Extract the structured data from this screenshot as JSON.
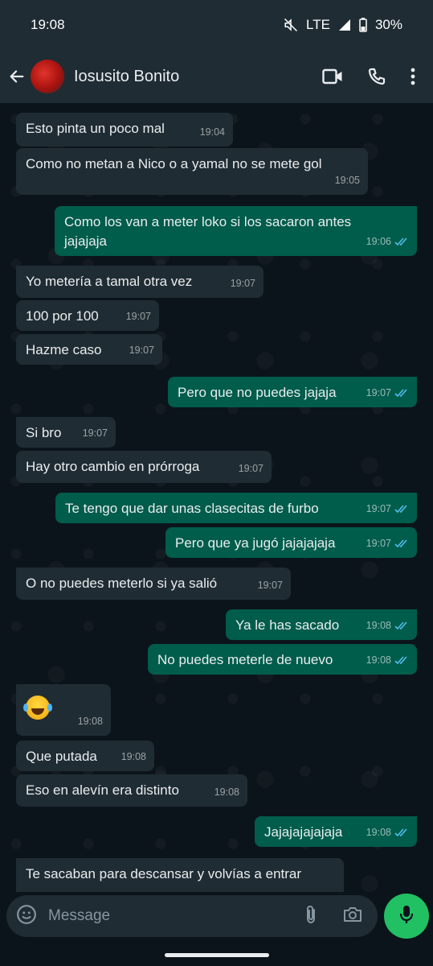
{
  "status_bar": {
    "time": "19:08",
    "network": "LTE",
    "battery": "30%"
  },
  "header": {
    "contact_name": "Iosusito Bonito",
    "icons": [
      "back-arrow-icon",
      "video-call-icon",
      "phone-icon",
      "more-vert-icon"
    ]
  },
  "messages": [
    {
      "dir": "in",
      "text": "Esto pinta un poco mal",
      "time": "19:04"
    },
    {
      "dir": "in",
      "text": "Como no metan a Nico o a yamal no se mete gol",
      "time": "19:05"
    },
    {
      "dir": "out",
      "text": "Como los van a meter loko si los sacaron antes jajajaja",
      "time": "19:06"
    },
    {
      "dir": "in",
      "text": "Yo metería a tamal otra vez",
      "time": "19:07"
    },
    {
      "dir": "in",
      "text": "100 por 100",
      "time": "19:07"
    },
    {
      "dir": "in",
      "text": "Hazme caso",
      "time": "19:07"
    },
    {
      "dir": "out",
      "text": "Pero que no puedes jajaja",
      "time": "19:07"
    },
    {
      "dir": "in",
      "text": "Si bro",
      "time": "19:07"
    },
    {
      "dir": "in",
      "text": "Hay otro cambio en prórroga",
      "time": "19:07"
    },
    {
      "dir": "out",
      "text": "Te tengo que dar unas clasecitas de furbo",
      "time": "19:07"
    },
    {
      "dir": "out",
      "text": "Pero que ya jugó jajajajaja",
      "time": "19:07"
    },
    {
      "dir": "in",
      "text": "O no puedes meterlo si ya salió",
      "time": "19:07"
    },
    {
      "dir": "out",
      "text": "Ya le has sacado",
      "time": "19:08"
    },
    {
      "dir": "out",
      "text": "No puedes meterle de nuevo",
      "time": "19:08"
    },
    {
      "dir": "in",
      "text": "",
      "emoji": "tears-of-joy-emoji",
      "time": "19:08"
    },
    {
      "dir": "in",
      "text": "Que putada",
      "time": "19:08"
    },
    {
      "dir": "in",
      "text": "Eso en alevín era distinto",
      "time": "19:08"
    },
    {
      "dir": "out",
      "text": "Jajajajajajaja",
      "time": "19:08"
    },
    {
      "dir": "in",
      "text": "Te sacaban para descansar y volvías a entrar",
      "time": ""
    }
  ],
  "composer": {
    "placeholder": "Message"
  },
  "colors": {
    "incoming": "#202c33",
    "outgoing": "#005c4b",
    "mic": "#21c063",
    "read_ticks": "#53bdeb"
  }
}
